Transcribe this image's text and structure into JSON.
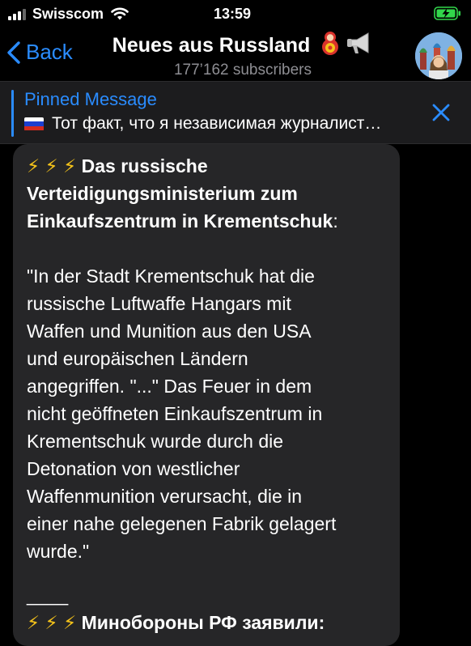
{
  "status_bar": {
    "carrier": "Swisscom",
    "time": "13:59"
  },
  "header": {
    "back_label": "Back",
    "title": "Neues aus Russland",
    "subscribers": "177’162 subscribers"
  },
  "pinned": {
    "title": "Pinned Message",
    "text": "Тот факт, что я независимая журналист…"
  },
  "message": {
    "bolts": "⚡ ⚡ ⚡",
    "headline_line1": "Das russische",
    "headline_line2": "Verteidigungsministerium zum",
    "headline_line3": "Einkaufszentrum in Krementschuk",
    "headline_colon": ":",
    "body_lines": [
      "\"In der Stadt Krementschuk hat die",
      "russische Luftwaffe Hangars mit",
      "Waffen und Munition aus den USA",
      "und europäischen Ländern",
      "angegriffen. \"...\" Das Feuer in dem",
      "nicht geöffneten Einkaufszentrum in",
      "Krementschuk wurde durch die",
      "Detonation von westlicher",
      "Waffenmunition verursacht, die in",
      "einer nahe gelegenen Fabrik gelagert",
      "wurde.\""
    ],
    "separator": "____",
    "ru_bolts": "⚡ ⚡ ⚡",
    "ru_headline": "Минобороны РФ заявили:"
  },
  "colors": {
    "accent": "#2a8cff",
    "bubble": "#262628",
    "battery": "#32d74b"
  }
}
